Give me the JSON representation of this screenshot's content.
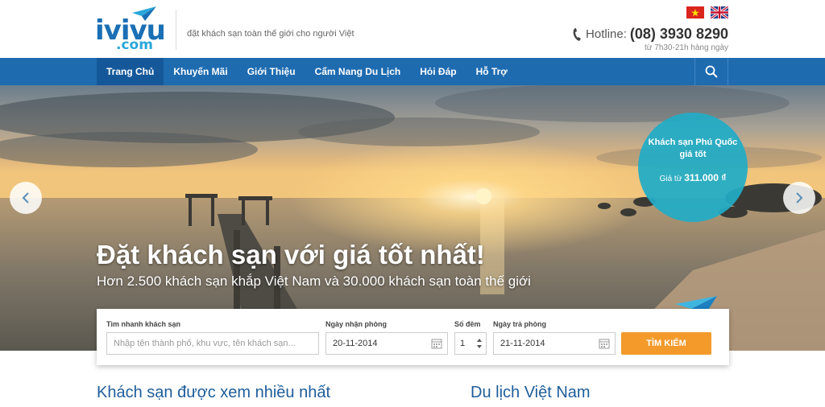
{
  "header": {
    "logo_main": "ivivu",
    "logo_sub": ".com",
    "tagline": "đặt khách sạn toàn thế giới cho người Việt",
    "hotline_label": "Hotline:",
    "hotline_number": "(08) 3930 8290",
    "hours": "từ 7h30-21h hàng ngày",
    "flags": [
      "vietnam-flag-icon",
      "uk-flag-icon"
    ]
  },
  "nav": {
    "items": [
      {
        "label": "Trang Chủ",
        "active": true
      },
      {
        "label": "Khuyến Mãi"
      },
      {
        "label": "Giới Thiệu"
      },
      {
        "label": "Cẩm Nang Du Lịch"
      },
      {
        "label": "Hỏi Đáp"
      },
      {
        "label": "Hỗ Trợ"
      }
    ],
    "search_icon": "search-icon"
  },
  "hero": {
    "title": "Đặt khách sạn với giá tốt nhất!",
    "subtitle": "Hơn 2.500 khách sạn khắp Việt Nam và 30.000 khách sạn toàn thế giới",
    "promo_title": "Khách sạn Phú Quốc giá tốt",
    "promo_price_label": "Giá từ",
    "promo_price": "311.000 ₫"
  },
  "search": {
    "hotel_label": "Tìm nhanh khách sạn",
    "hotel_placeholder": "Nhập tên thành phố, khu vực, tên khách sạn...",
    "checkin_label": "Ngày nhận phòng",
    "checkin_value": "20-11-2014",
    "nights_label": "Số đêm",
    "nights_value": "1",
    "checkout_label": "Ngày trả phòng",
    "checkout_value": "21-11-2014",
    "button_label": "TÌM KIẾM"
  },
  "sections": {
    "left_title": "Khách sạn được xem nhiều nhất",
    "right_title": "Du lịch Việt Nam"
  },
  "colors": {
    "nav_bg": "#1e6bb0",
    "accent_orange": "#f39a2b",
    "promo_teal": "#21acc6",
    "heading_blue": "#1e5d9a"
  }
}
